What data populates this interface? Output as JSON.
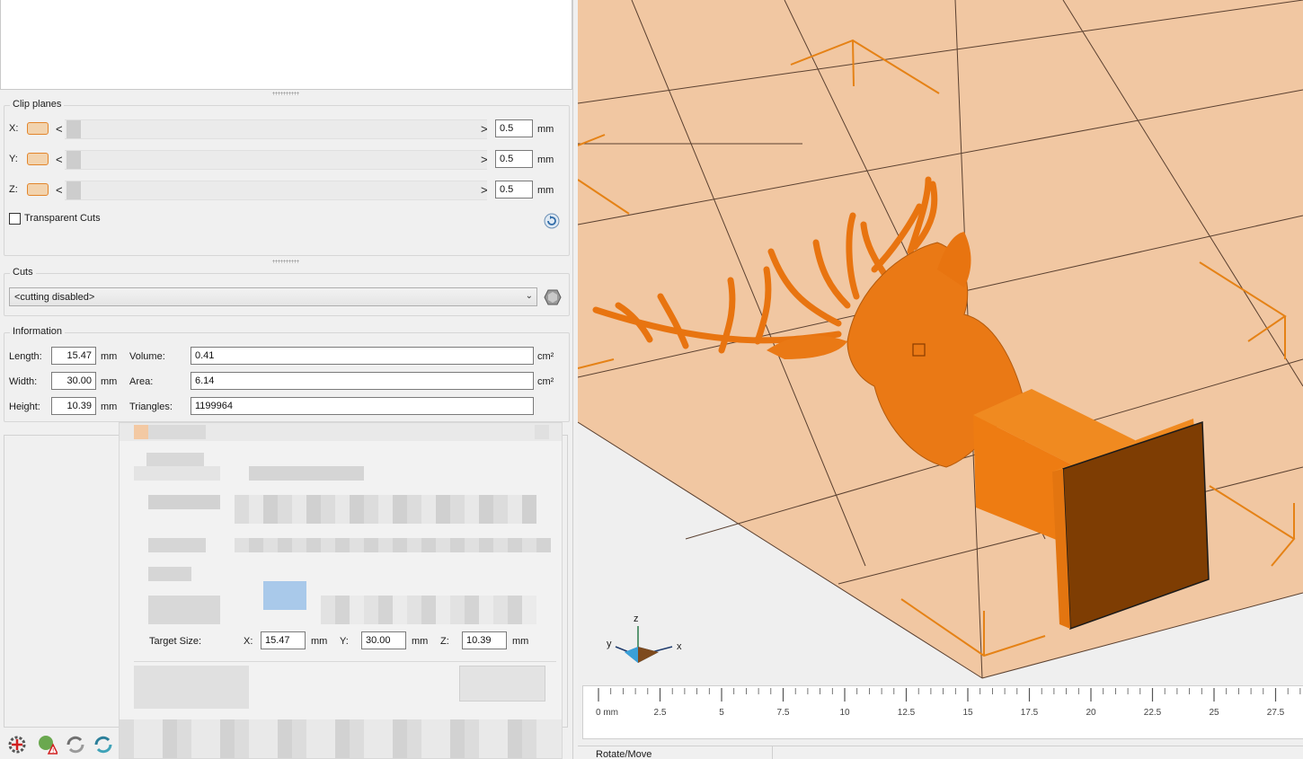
{
  "clip_planes": {
    "title": "Clip planes",
    "axes": [
      {
        "label": "X:",
        "value": "0.5",
        "unit": "mm"
      },
      {
        "label": "Y:",
        "value": "0.5",
        "unit": "mm"
      },
      {
        "label": "Z:",
        "value": "0.5",
        "unit": "mm"
      }
    ],
    "arrow_left": "<",
    "arrow_right": ">",
    "transparent_cuts_label": "Transparent Cuts",
    "transparent_cuts_checked": false
  },
  "cuts": {
    "title": "Cuts",
    "selected": "<cutting disabled>"
  },
  "information": {
    "title": "Information",
    "length_label": "Length:",
    "length_value": "15.47",
    "length_unit": "mm",
    "width_label": "Width:",
    "width_value": "30.00",
    "width_unit": "mm",
    "height_label": "Height:",
    "height_value": "10.39",
    "height_unit": "mm",
    "volume_label": "Volume:",
    "volume_value": "0.41",
    "volume_unit": "cm²",
    "area_label": "Area:",
    "area_value": "6.14",
    "area_unit": "cm²",
    "triangles_label": "Triangles:",
    "triangles_value": "1199964"
  },
  "scale_dialog": {
    "target_size_label": "Target Size:",
    "x_label": "X:",
    "x_value": "15.47",
    "x_unit": "mm",
    "y_label": "Y:",
    "y_value": "30.00",
    "y_unit": "mm",
    "z_label": "Z:",
    "z_value": "10.39",
    "z_unit": "mm"
  },
  "viewport": {
    "axis_x": "x",
    "axis_y": "y",
    "axis_z": "z",
    "ruler_ticks": [
      "0 mm",
      "2.5",
      "5",
      "7.5",
      "10",
      "12.5",
      "15",
      "17.5",
      "20",
      "22.5",
      "25",
      "27.5"
    ],
    "status_mode": "Rotate/Move",
    "colors": {
      "model": "#ee7a14",
      "plate": "#f0c8a4",
      "accent": "#e2852b"
    }
  }
}
